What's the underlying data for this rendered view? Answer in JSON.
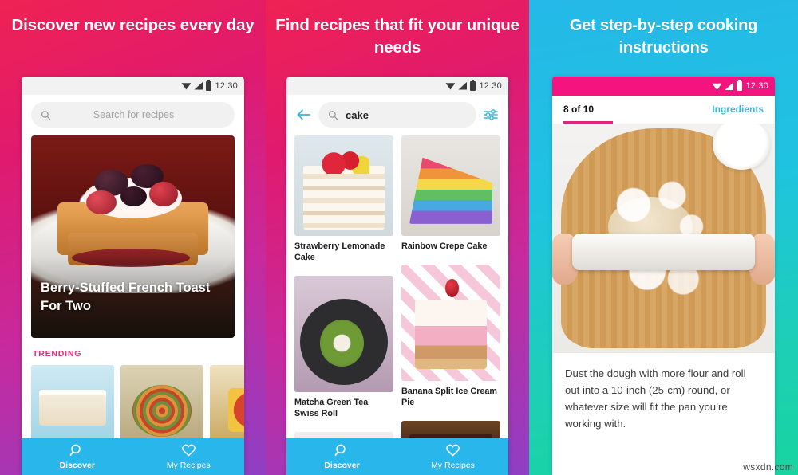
{
  "panels": [
    {
      "headline": "Discover new recipes every day",
      "status": {
        "time": "12:30",
        "icons": [
          "wifi-icon",
          "signal-icon",
          "battery-icon"
        ]
      },
      "search": {
        "placeholder": "Search for recipes",
        "value": "",
        "icon": "search-icon"
      },
      "hero": {
        "title": "Berry-Stuffed French Toast For Two"
      },
      "trending": {
        "label": "TRENDING",
        "items": [
          {
            "name": "funfetti-cake-thumb"
          },
          {
            "name": "vegetable-tart-thumb"
          },
          {
            "name": "pineapple-bowl-thumb"
          }
        ]
      },
      "nav": [
        {
          "label": "Discover",
          "icon": "search-icon",
          "active": true
        },
        {
          "label": "My Recipes",
          "icon": "heart-icon",
          "active": false
        }
      ]
    },
    {
      "headline": "Find recipes that fit your unique needs",
      "status": {
        "time": "12:30"
      },
      "search": {
        "value": "cake",
        "placeholder": "Search for recipes",
        "icon": "search-icon",
        "back_icon": "back-arrow-icon",
        "filter_icon": "filter-sliders-icon"
      },
      "results": [
        {
          "title": "Strawberry Lemonade Cake",
          "thumb": "strawberry-lemonade-cake-thumb",
          "column": 0
        },
        {
          "title": "Rainbow Crepe Cake",
          "thumb": "rainbow-crepe-cake-thumb",
          "column": 1
        },
        {
          "title": "Matcha Green Tea Swiss Roll",
          "thumb": "matcha-swiss-roll-thumb",
          "column": 0
        },
        {
          "title": "Banana Split Ice Cream Pie",
          "thumb": "banana-split-pie-thumb",
          "column": 1
        }
      ],
      "nav": [
        {
          "label": "Discover",
          "icon": "search-icon",
          "active": true
        },
        {
          "label": "My Recipes",
          "icon": "heart-icon",
          "active": false
        }
      ]
    },
    {
      "headline": "Get step-by-step cooking instructions",
      "status": {
        "time": "12:30"
      },
      "step": {
        "counter": "8 of 10",
        "ingredients_link": "Ingredients",
        "progress_percent": 80,
        "photo": "rolling-pin-dough-photo",
        "instruction": "Dust the dough with more flour and roll out into a 10-inch (25-cm) round, or whatever size will fit the pan you’re working with."
      }
    }
  ],
  "watermark": "wsxdn.com",
  "colors": {
    "gradient_pink_start": "#ef2253",
    "gradient_purple_end": "#8e3fc4",
    "gradient_cyan_start": "#25b8e8",
    "gradient_teal_end": "#17d4a0",
    "nav_blue": "#29b6ea",
    "trending_pink": "#ec2a7f",
    "status_pink": "#f4137f",
    "link_cyan": "#3ab7d8",
    "progress_magenta": "#e0257f"
  }
}
